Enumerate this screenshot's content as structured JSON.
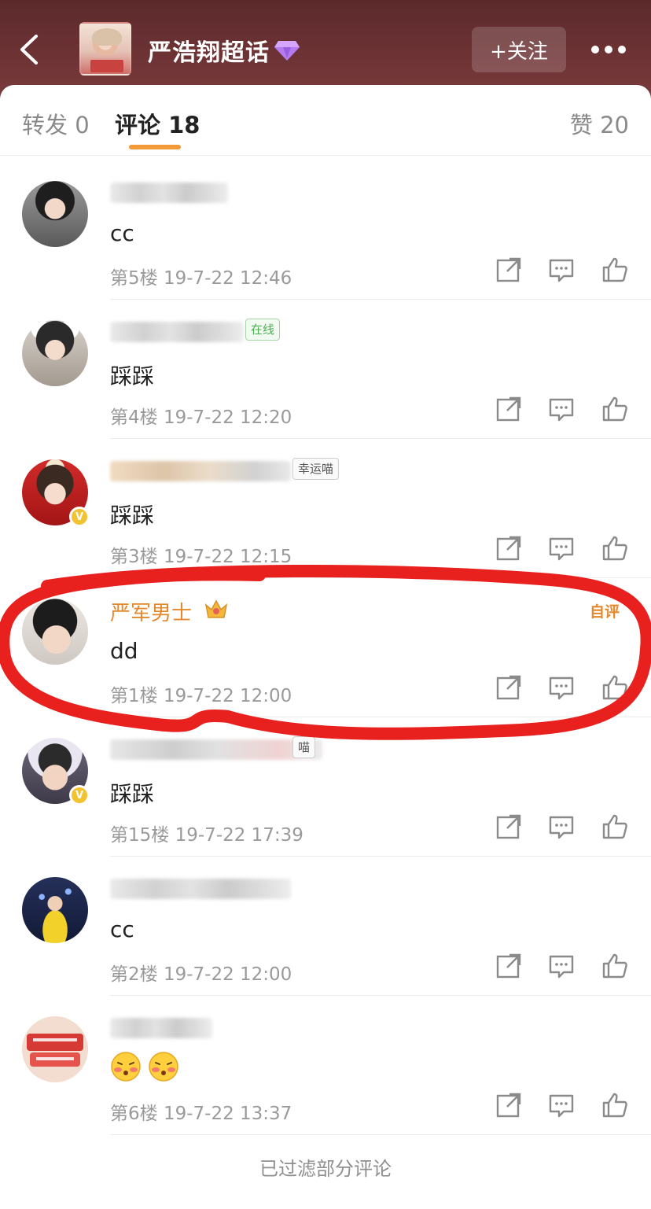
{
  "header": {
    "topic_title": "严浩翔超话",
    "follow_label": "+关注"
  },
  "tabs": {
    "repost": "转发 0",
    "comments": "评论 18",
    "likes": "赞 20"
  },
  "comments": [
    {
      "name": "",
      "badge": "",
      "content": "cc",
      "meta": "第5楼 19-7-22 12:46"
    },
    {
      "name": "",
      "badge": "在线",
      "content": "踩踩",
      "meta": "第4楼 19-7-22 12:20"
    },
    {
      "name": "",
      "badge": "幸运喵",
      "content": "踩踩",
      "meta": "第3楼 19-7-22 12:15"
    },
    {
      "name": "严军男士",
      "badge": "",
      "author_tag": "自评",
      "content": "dd",
      "meta": "第1楼 19-7-22 12:00"
    },
    {
      "name": "",
      "badge": "喵",
      "content": "踩踩",
      "meta": "第15楼 19-7-22 17:39"
    },
    {
      "name": "",
      "badge": "",
      "content": "cc",
      "meta": "第2楼 19-7-22 12:00"
    },
    {
      "name": "",
      "badge": "",
      "content": "",
      "emoji": [
        "blushing-face",
        "blushing-face"
      ],
      "meta": "第6楼 19-7-22 13:37"
    }
  ],
  "footer_note": "已过滤部分评论",
  "colors": {
    "header_bg": "#6e3335",
    "accent_orange": "#f29a38",
    "name_orange": "#e5882c",
    "highlight_red": "#e8201e"
  }
}
